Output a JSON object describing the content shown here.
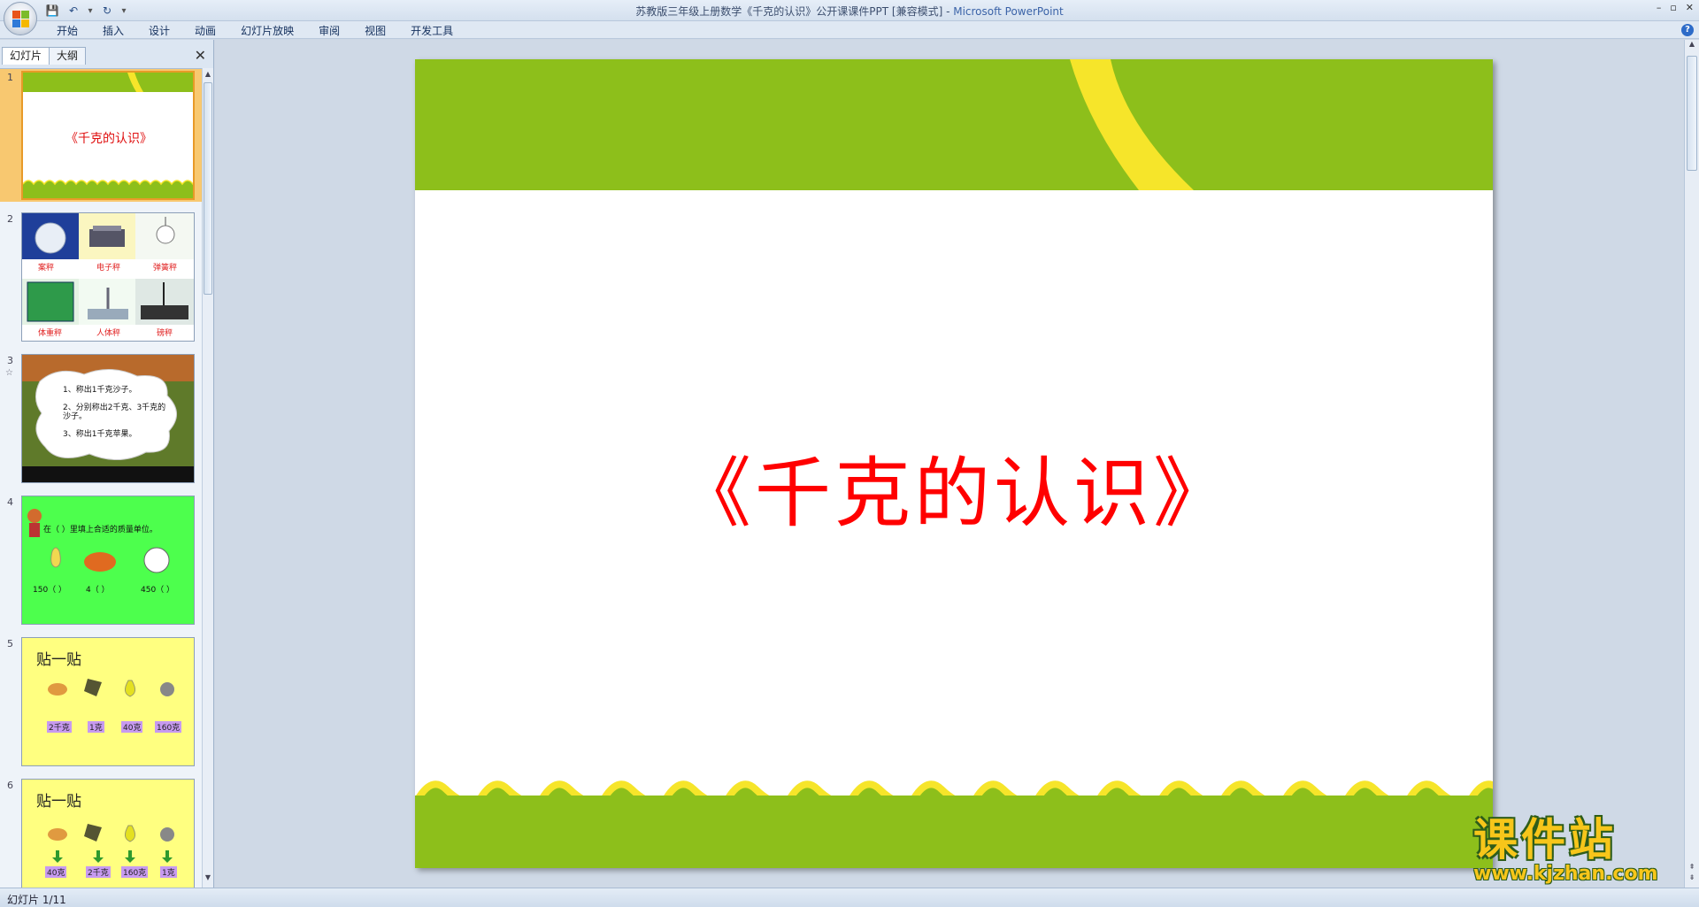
{
  "window": {
    "title": "苏教版三年级上册数学《千克的认识》公开课课件PPT [兼容模式] - ",
    "app_name": "Microsoft PowerPoint",
    "controls": [
      "–",
      "▫",
      "✕"
    ]
  },
  "qat": {
    "save": "💾",
    "undo": "↶",
    "redo": "↻",
    "more": "▾"
  },
  "ribbon": {
    "tabs": [
      "开始",
      "插入",
      "设计",
      "动画",
      "幻灯片放映",
      "审阅",
      "视图",
      "开发工具"
    ],
    "help": "?"
  },
  "left_pane": {
    "tabs": [
      "幻灯片",
      "大纲"
    ],
    "close": "✕",
    "slides": [
      {
        "num": "1",
        "title": "《千克的认识》"
      },
      {
        "num": "2",
        "labels": [
          "案秤",
          "电子秤",
          "弹簧秤",
          "体重秤",
          "人体秤",
          "磅秤"
        ]
      },
      {
        "num": "3",
        "star": "☆",
        "lines": [
          "1、称出1千克沙子。",
          "2、分别称出2千克、3千克的",
          "沙子。",
          "3、称出1千克苹果。"
        ]
      },
      {
        "num": "4",
        "prompt": "在（ ）里填上合适的质量单位。",
        "values": [
          "150（  ）",
          "4（  ）",
          "450（  ）"
        ]
      },
      {
        "num": "5",
        "heading": "贴一贴",
        "tags": [
          "2千克",
          "1克",
          "40克",
          "160克"
        ]
      },
      {
        "num": "6",
        "heading": "贴一贴",
        "tags": [
          "40克",
          "2千克",
          "160克",
          "1克"
        ]
      }
    ]
  },
  "slide": {
    "title": "《千克的认识》"
  },
  "status": {
    "text": "幻灯片 1/11"
  },
  "watermark": {
    "title": "课件站",
    "url": "www.kjzhan.com"
  },
  "colors": {
    "slide_green": "#8dbf1b",
    "slide_yellow": "#f6e52a",
    "title_red": "#ff0000",
    "selected_thumb": "#f8c870"
  }
}
